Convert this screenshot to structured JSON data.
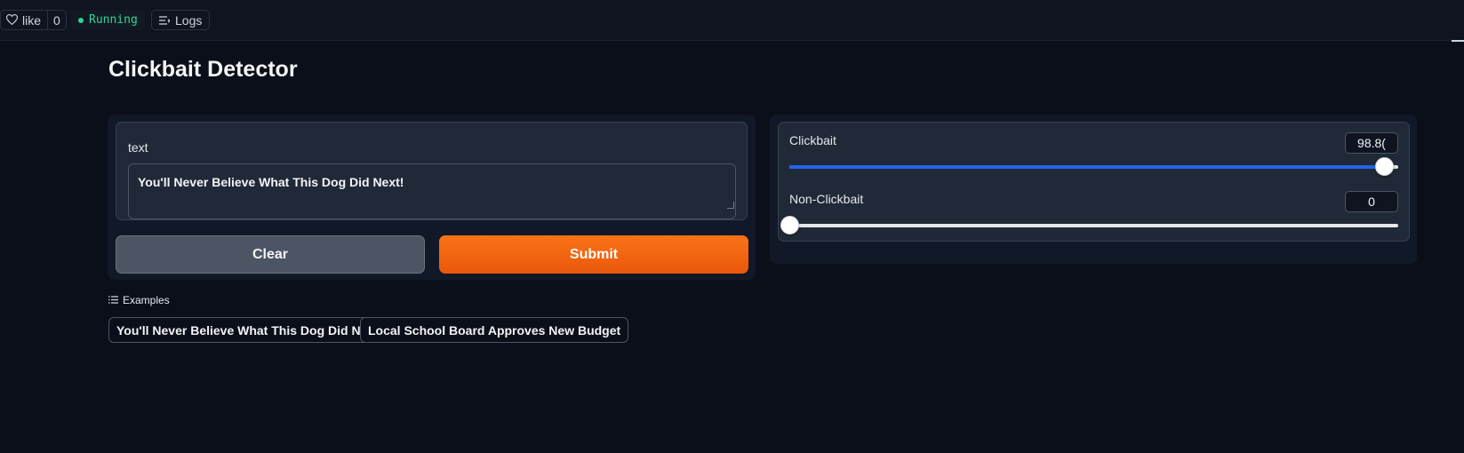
{
  "header": {
    "like_label": "like",
    "like_count": "0",
    "status_label": "Running",
    "status_color": "#34d399",
    "logs_label": "Logs"
  },
  "page": {
    "title": "Clickbait Detector"
  },
  "input": {
    "label": "text",
    "value": "You'll Never Believe What This Dog Did Next!"
  },
  "buttons": {
    "clear_label": "Clear",
    "submit_label": "Submit",
    "submit_color": "#f97316"
  },
  "outputs": [
    {
      "label": "Clickbait",
      "display": "98.8(",
      "fraction": 0.976
    },
    {
      "label": "Non-Clickbait",
      "display": "0",
      "fraction": 0.0
    }
  ],
  "examples": {
    "heading": "Examples",
    "items": [
      "You'll Never Believe What This Dog Did Next!",
      "Local School Board Approves New Budget"
    ]
  }
}
